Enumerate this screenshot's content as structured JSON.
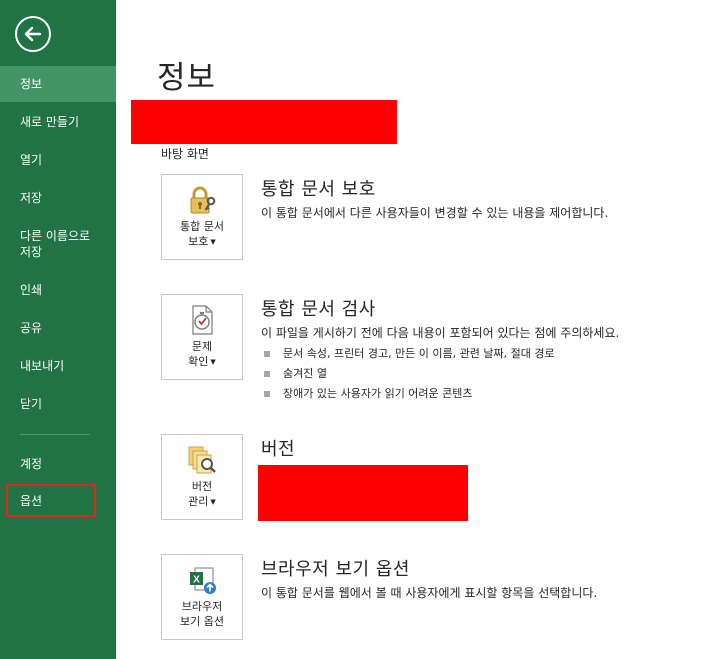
{
  "sidebar": {
    "items": [
      {
        "label": "정보",
        "active": true
      },
      {
        "label": "새로 만들기"
      },
      {
        "label": "열기"
      },
      {
        "label": "저장"
      },
      {
        "label": "다른 이름으로\n저장"
      },
      {
        "label": "인쇄"
      },
      {
        "label": "공유"
      },
      {
        "label": "내보내기"
      },
      {
        "label": "닫기"
      },
      {
        "label": "계정"
      },
      {
        "label": "옵션"
      }
    ]
  },
  "main": {
    "title": "정보",
    "location": "바탕 화면",
    "sections": [
      {
        "tile_label_1": "통합 문서",
        "tile_label_2": "보호",
        "title": "통합 문서 보호",
        "description": "이 통합 문서에서 다른 사용자들이 변경할 수 있는 내용을 제어합니다."
      },
      {
        "tile_label_1": "문제",
        "tile_label_2": "확인",
        "title": "통합 문서 검사",
        "description": "이 파일을 게시하기 전에 다음 내용이 포함되어 있다는 점에 주의하세요.",
        "bullets": [
          "문서 속성, 프린터 경고, 만든 이 이름, 관련 날짜, 절대 경로",
          "숨겨진 열",
          "장애가 있는 사용자가 읽기 어려운 콘텐츠"
        ]
      },
      {
        "tile_label_1": "버전",
        "tile_label_2": "관리",
        "title": "버전"
      },
      {
        "tile_label_1": "브라우저",
        "tile_label_2": "보기 옵션",
        "title": "브라우저 보기 옵션",
        "description": "이 통합 문서를 웹에서 볼 때 사용자에게 표시할 항목을 선택합니다."
      }
    ]
  },
  "colors": {
    "sidebar": "#217346",
    "sidebar_active": "#439467",
    "redaction": "#ff0000",
    "highlight_box": "#e3241b"
  },
  "icons": [
    "back-arrow-icon",
    "lock-key-icon",
    "inspect-document-icon",
    "version-magnifier-icon",
    "excel-browser-icon"
  ]
}
